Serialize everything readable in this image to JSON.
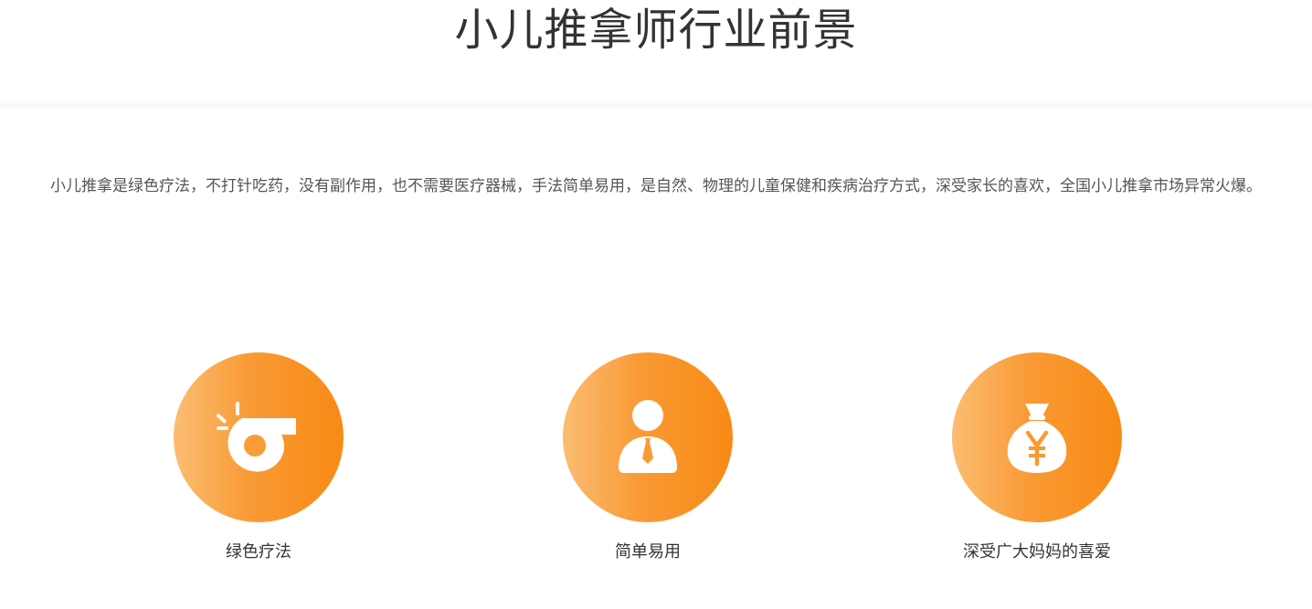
{
  "header": {
    "title": "小儿推拿师行业前景"
  },
  "intro": {
    "text": "小儿推拿是绿色疗法，不打针吃药，没有副作用，也不需要医疗器械，手法简单易用，是自然、物理的儿童保健和疾病治疗方式，深受家长的喜欢，全国小儿推拿市场异常火爆。"
  },
  "features": [
    {
      "label": "绿色疗法",
      "icon": "whistle-icon"
    },
    {
      "label": "简单易用",
      "icon": "person-icon"
    },
    {
      "label": "深受广大妈妈的喜爱",
      "icon": "money-bag-icon"
    }
  ],
  "colors": {
    "gradient_start": "#fbbd72",
    "gradient_end": "#f88a14",
    "title_text": "#333333",
    "body_text": "#555555"
  }
}
